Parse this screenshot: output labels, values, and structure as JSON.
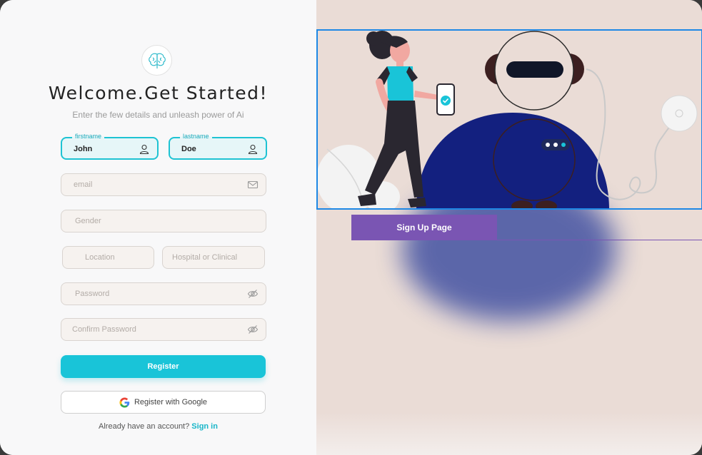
{
  "header": {
    "title": "Welcome.Get Started!",
    "subtitle": "Enter the few details and unleash power of Ai",
    "logo_icon": "brain-icon"
  },
  "form": {
    "firstname": {
      "label": "firstname",
      "value": "John"
    },
    "lastname": {
      "label": "lastname",
      "value": "Doe"
    },
    "email": {
      "placeholder": "email"
    },
    "gender": {
      "placeholder": "Gender"
    },
    "location": {
      "placeholder": "Location"
    },
    "hospital": {
      "placeholder": "Hospital  or Clinical"
    },
    "password": {
      "placeholder": "Password"
    },
    "confirm_password": {
      "placeholder": "Confirm Password"
    }
  },
  "buttons": {
    "register": "Register",
    "google": "Register with Google",
    "signup_page": "Sign Up Page"
  },
  "footer": {
    "prompt": "Already have an account?",
    "signin": "Sign in"
  },
  "colors": {
    "accent": "#19c4d8",
    "purple": "#7a55b3",
    "navy": "#13207f",
    "selection": "#1e88e5"
  }
}
